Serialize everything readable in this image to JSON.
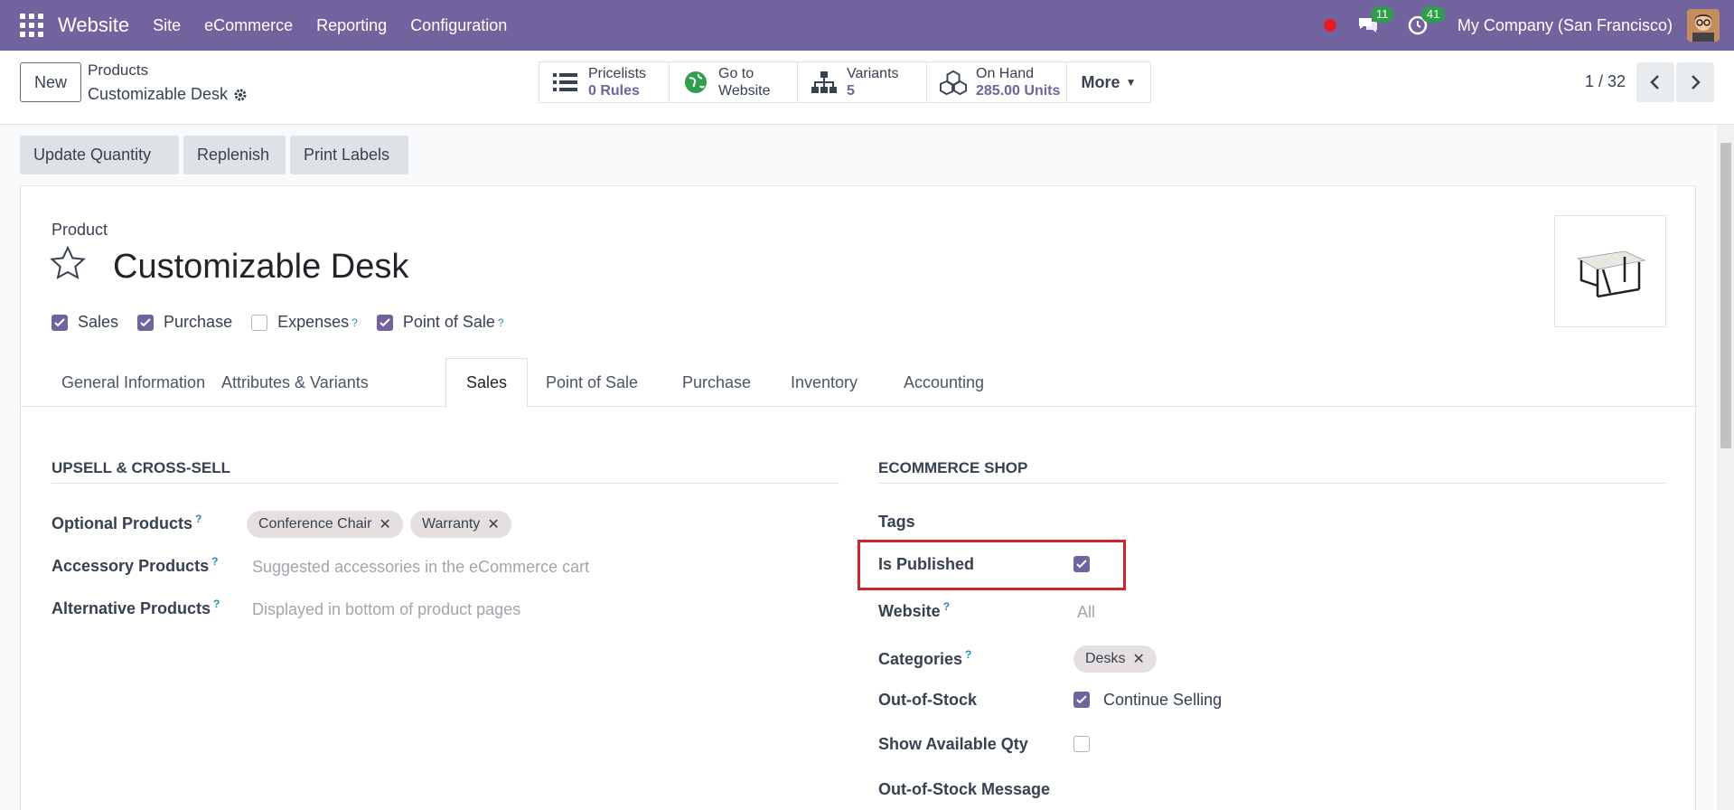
{
  "navbar": {
    "brand": "Website",
    "menu": [
      "Site",
      "eCommerce",
      "Reporting",
      "Configuration"
    ],
    "chat_count": "11",
    "activity_count": "41",
    "company": "My Company (San Francisco)"
  },
  "control_panel": {
    "new_label": "New",
    "breadcrumb_parent": "Products",
    "breadcrumb_current": "Customizable Desk",
    "smart_buttons": {
      "pricelists": {
        "line1": "Pricelists",
        "line2": "0 Rules"
      },
      "website": {
        "line1": "Go to",
        "line2": "Website"
      },
      "variants": {
        "line1": "Variants",
        "line2": "5"
      },
      "onhand": {
        "line1": "On Hand",
        "line2": "285.00 Units"
      },
      "more": "More"
    },
    "pager": "1 / 32"
  },
  "actions": {
    "update_qty": "Update Quantity",
    "replenish": "Replenish",
    "print_labels": "Print Labels"
  },
  "form": {
    "product_label": "Product",
    "name": "Customizable Desk",
    "flags": {
      "sales": "Sales",
      "purchase": "Purchase",
      "expenses": "Expenses",
      "pos": "Point of Sale"
    },
    "tabs": [
      "General Information",
      "Attributes & Variants",
      "Sales",
      "Point of Sale",
      "Purchase",
      "Inventory",
      "Accounting"
    ],
    "upsell": {
      "title": "UPSELL & CROSS-SELL",
      "optional_label": "Optional Products",
      "optional_tags": [
        "Conference Chair",
        "Warranty"
      ],
      "accessory_label": "Accessory Products",
      "accessory_placeholder": "Suggested accessories in the eCommerce cart",
      "alternative_label": "Alternative Products",
      "alternative_placeholder": "Displayed in bottom of product pages"
    },
    "ecommerce": {
      "title": "ECOMMERCE SHOP",
      "tags_label": "Tags",
      "published_label": "Is Published",
      "website_label": "Website",
      "website_placeholder": "All",
      "categories_label": "Categories",
      "category_tag": "Desks",
      "oos_label": "Out-of-Stock",
      "oos_value": "Continue Selling",
      "show_qty_label": "Show Available Qty",
      "oos_message_label": "Out-of-Stock Message"
    }
  },
  "colors": {
    "navbar": "#71639e",
    "accent": "#71639e",
    "highlight": "#d0242b"
  }
}
